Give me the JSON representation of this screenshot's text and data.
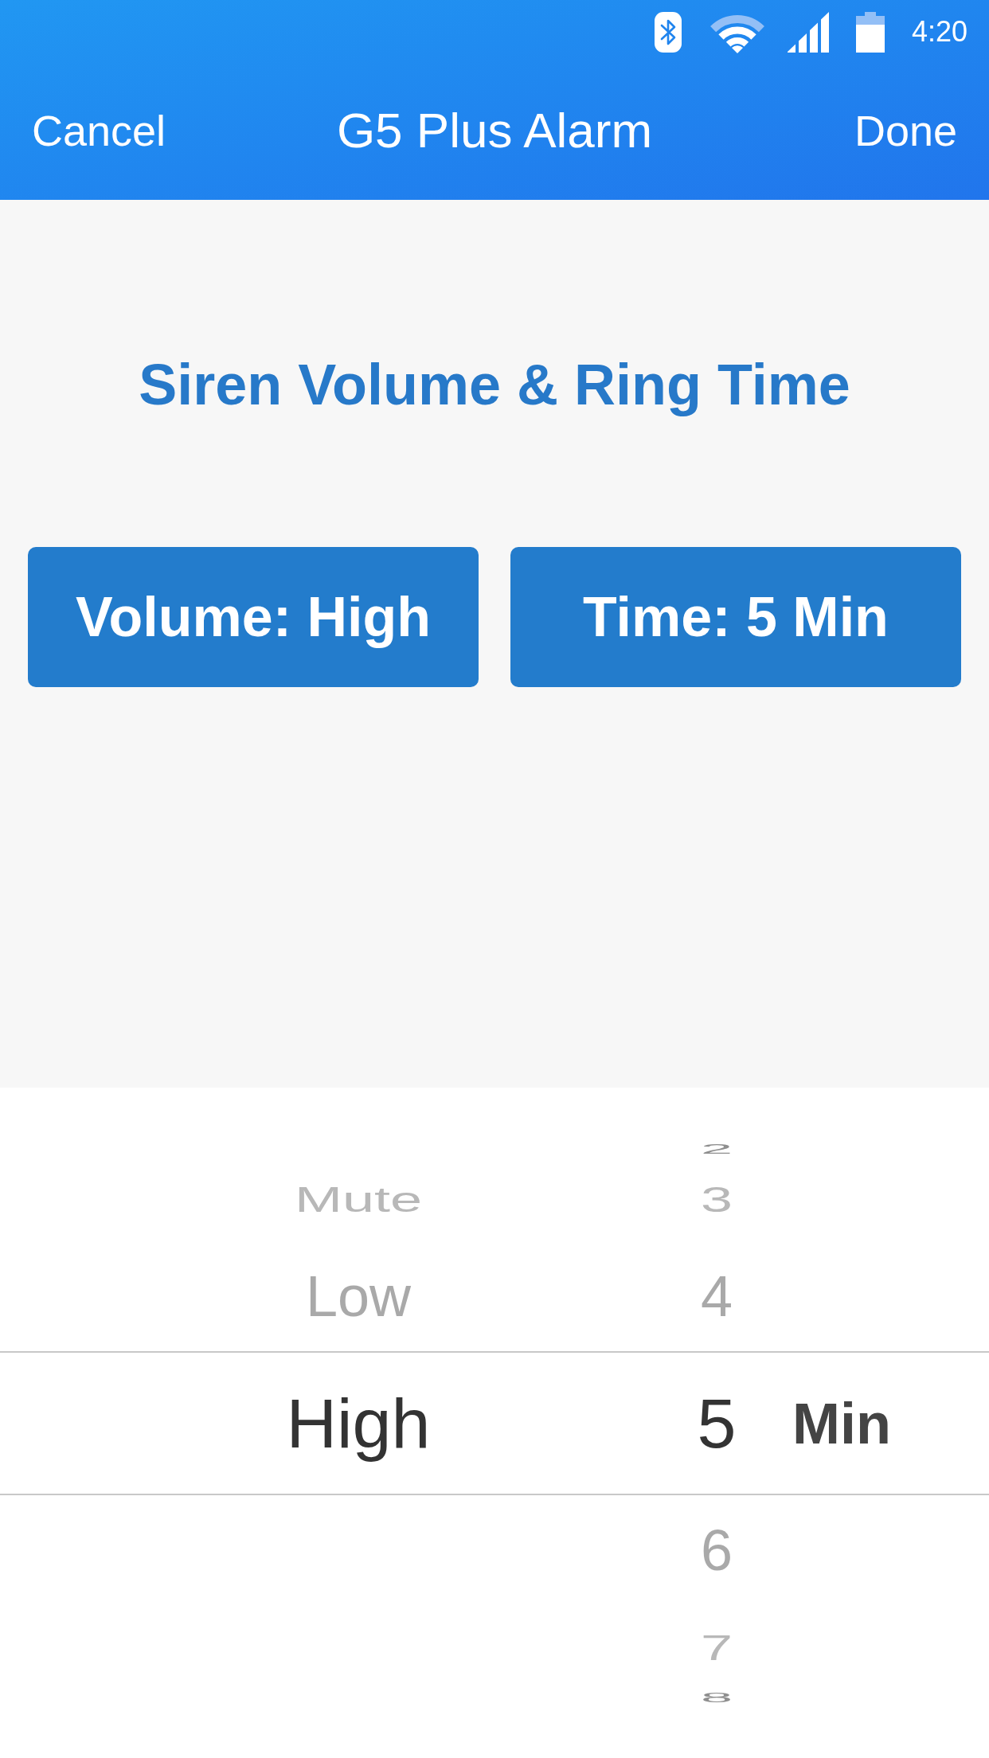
{
  "status_bar": {
    "time": "4:20"
  },
  "nav_bar": {
    "cancel": "Cancel",
    "title": "G5 Plus Alarm",
    "done": "Done"
  },
  "heading": "Siren Volume & Ring Time",
  "buttons": [
    {
      "label": "Volume: High"
    },
    {
      "label": "Time: 5 Min"
    }
  ],
  "picker": {
    "columns": [
      {
        "items": [
          {
            "label": "Mute",
            "selected": false
          },
          {
            "label": "Low",
            "selected": false
          },
          {
            "label": "High",
            "selected": true
          }
        ]
      },
      {
        "items": [
          {
            "label": "2",
            "selected": false
          },
          {
            "label": "3",
            "selected": false
          },
          {
            "label": "4",
            "selected": false
          },
          {
            "label": "5",
            "selected": true
          },
          {
            "label": "6",
            "selected": false
          },
          {
            "label": "7",
            "selected": false
          },
          {
            "label": "8",
            "selected": false
          }
        ],
        "unit": "Min"
      }
    ]
  }
}
